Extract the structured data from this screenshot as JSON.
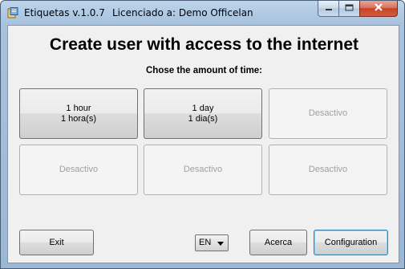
{
  "window": {
    "app_title": "Etiquetas v.1.0.7",
    "license_text": "Licenciado a: Demo Officelan",
    "controls": {
      "minimize": "minimize-icon",
      "maximize": "maximize-icon",
      "close": "close-icon"
    }
  },
  "main": {
    "heading": "Create user with access to the internet",
    "subheading": "Chose the amount of time:",
    "tiles": [
      {
        "line1": "1 hour",
        "line2": "1 hora(s)",
        "enabled": true
      },
      {
        "line1": "1 day",
        "line2": "1 dia(s)",
        "enabled": true
      },
      {
        "line1": "Desactivo",
        "line2": "",
        "enabled": false
      },
      {
        "line1": "Desactivo",
        "line2": "",
        "enabled": false
      },
      {
        "line1": "Desactivo",
        "line2": "",
        "enabled": false
      },
      {
        "line1": "Desactivo",
        "line2": "",
        "enabled": false
      }
    ]
  },
  "footer": {
    "exit_label": "Exit",
    "language_value": "EN",
    "about_label": "Acerca",
    "configuration_label": "Configuration"
  },
  "colors": {
    "titlebar": "#a9c3de",
    "close_button": "#c5432b",
    "client_bg": "#f0f0f0",
    "disabled_text": "#a0a0a0"
  }
}
